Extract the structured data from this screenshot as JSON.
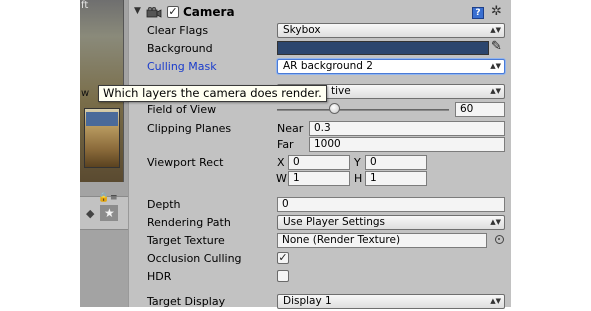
{
  "scene": {
    "overlay_text": "ft",
    "edge_text": "w"
  },
  "component": {
    "title": "Camera",
    "enabled_mark": "✓",
    "help_glyph": "?",
    "settings_glyph": "✲"
  },
  "fields": {
    "clear_flags": {
      "label": "Clear Flags",
      "value": "Skybox"
    },
    "background": {
      "label": "Background",
      "color": "#2c466e"
    },
    "culling_mask": {
      "label": "Culling Mask",
      "value": "AR background 2"
    },
    "projection": {
      "value": "tive"
    },
    "field_of_view": {
      "label": "Field of View",
      "value": "60",
      "fraction": 0.33
    },
    "clipping_planes": {
      "label": "Clipping Planes",
      "near_label": "Near",
      "near": "0.3",
      "far_label": "Far",
      "far": "1000"
    },
    "viewport_rect": {
      "label": "Viewport Rect",
      "x_label": "X",
      "x": "0",
      "y_label": "Y",
      "y": "0",
      "w_label": "W",
      "w": "1",
      "h_label": "H",
      "h": "1"
    },
    "depth": {
      "label": "Depth",
      "value": "0"
    },
    "rendering_path": {
      "label": "Rendering Path",
      "value": "Use Player Settings"
    },
    "target_texture": {
      "label": "Target Texture",
      "value": "None (Render Texture)"
    },
    "occlusion_culling": {
      "label": "Occlusion Culling",
      "checked": true,
      "mark": "✓"
    },
    "hdr": {
      "label": "HDR",
      "checked": false
    },
    "target_display": {
      "label": "Target Display",
      "value": "Display 1"
    }
  },
  "tooltip": {
    "text": "Which layers the camera does render."
  },
  "popup_arrows": "▲▼"
}
